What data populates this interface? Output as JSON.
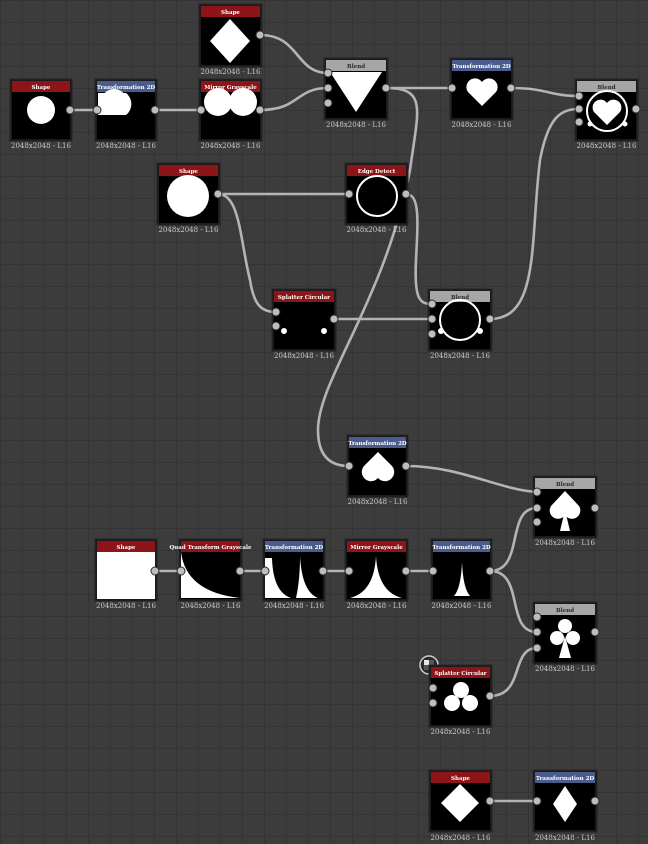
{
  "nodes": [
    {
      "id": "shape-diamond-top",
      "title": "Shape",
      "resolution": "2048x2048 - L16",
      "header": "red"
    },
    {
      "id": "blend-top",
      "title": "Blend",
      "resolution": "2048x2048 - L16",
      "header": "gray"
    },
    {
      "id": "shape-circle-small",
      "title": "Shape",
      "resolution": "2048x2048 - L16",
      "header": "red"
    },
    {
      "id": "transform-half-circle",
      "title": "Transformation 2D",
      "resolution": "2048x2048 - L16",
      "header": "blue"
    },
    {
      "id": "mirror-grayscale-1",
      "title": "Mirror Grayscale",
      "resolution": "2048x2048 - L16",
      "header": "red"
    },
    {
      "id": "transform-heart",
      "title": "Transformation 2D",
      "resolution": "2048x2048 - L16",
      "header": "blue"
    },
    {
      "id": "blend-heart-final",
      "title": "Blend",
      "resolution": "2048x2048 - L16",
      "header": "gray"
    },
    {
      "id": "shape-circle-big",
      "title": "Shape",
      "resolution": "2048x2048 - L16",
      "header": "red"
    },
    {
      "id": "edge-detect",
      "title": "Edge Detect",
      "resolution": "2048x2048 - L16",
      "header": "red"
    },
    {
      "id": "splatter-circular-1",
      "title": "Splatter Circular",
      "resolution": "2048x2048 - L16",
      "header": "red"
    },
    {
      "id": "blend-ring",
      "title": "Blend",
      "resolution": "2048x2048 - L16",
      "header": "gray"
    },
    {
      "id": "transform-inverted-heart",
      "title": "Transformation 2D",
      "resolution": "2048x2048 - L16",
      "header": "blue"
    },
    {
      "id": "blend-spade",
      "title": "Blend",
      "resolution": "2048x2048 - L16",
      "header": "gray"
    },
    {
      "id": "shape-square",
      "title": "Shape",
      "resolution": "2048x2048 - L16",
      "header": "red"
    },
    {
      "id": "quad-transform",
      "title": "Quad Transform Grayscale",
      "resolution": "2048x2048 - L16",
      "header": "red"
    },
    {
      "id": "transform-curve",
      "title": "Transformation 2D",
      "resolution": "2048x2048 - L16",
      "header": "blue"
    },
    {
      "id": "mirror-grayscale-2",
      "title": "Mirror Grayscale",
      "resolution": "2048x2048 - L16",
      "header": "red"
    },
    {
      "id": "transform-stem",
      "title": "Transformation 2D",
      "resolution": "2048x2048 - L16",
      "header": "blue"
    },
    {
      "id": "blend-club",
      "title": "Blend",
      "resolution": "2048x2048 - L16",
      "header": "gray"
    },
    {
      "id": "splatter-circular-2",
      "title": "Splatter Circular",
      "resolution": "2048x2048 - L16",
      "header": "red"
    },
    {
      "id": "shape-diamond-bottom",
      "title": "Shape",
      "resolution": "2048x2048 - L16",
      "header": "red"
    },
    {
      "id": "transform-diamond",
      "title": "Transformation 2D",
      "resolution": "2048x2048 - L16",
      "header": "blue"
    }
  ],
  "colors": {
    "canvas": "#3c3c3c",
    "grid": "#343434",
    "header_red": "#8d1418",
    "header_blue": "#4a5c8c",
    "header_gray": "#a6a6a6",
    "wire": "#b4b4b4"
  },
  "icons": {
    "pin": "checker-pin-icon"
  }
}
